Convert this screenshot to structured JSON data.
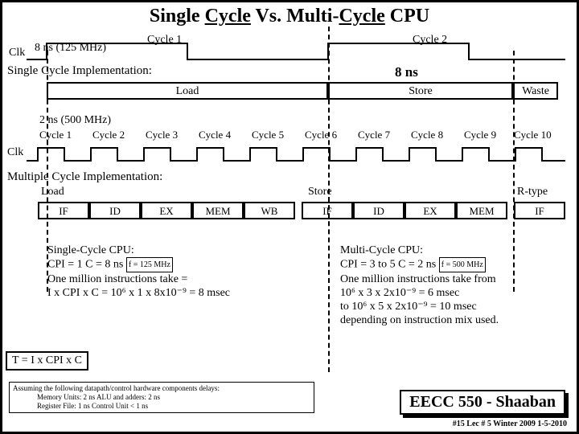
{
  "title_parts": {
    "p": "Single ",
    "u1": "Cycle",
    "mid": " Vs.  Multi-",
    "u2": "Cycle",
    "end": " CPU"
  },
  "single": {
    "clk": "Clk",
    "ns125": "8 ns (125 MHz)",
    "cycle1": "Cycle 1",
    "cycle2": "Cycle 2",
    "impl": "Single Cycle Implementation:",
    "eight": "8 ns",
    "load": "Load",
    "store": "Store",
    "waste": "Waste"
  },
  "multi": {
    "mhz": "2 ns   (500 MHz)",
    "cycles": [
      "Cycle 1",
      "Cycle 2",
      "Cycle 3",
      "Cycle 4",
      "Cycle 5",
      "Cycle 6",
      "Cycle 7",
      "Cycle 8",
      "Cycle 9",
      "Cycle 10"
    ],
    "clk": "Clk",
    "impl": "Multiple Cycle Implementation:",
    "load": "Load",
    "store": "Store",
    "rtype": "R-type",
    "stages": [
      "IF",
      "ID",
      "EX",
      "MEM",
      "WB",
      "IF",
      "ID",
      "EX",
      "MEM",
      "IF"
    ]
  },
  "calcL": {
    "h": "Single-Cycle CPU:",
    "l1a": "CPI = 1    C = 8 ns",
    "fbox": "f = 125 MHz",
    "l2": "One million instructions take =",
    "l3": "I x CPI x C  =  10⁶ x 1 x 8x10⁻⁹ =  8 msec"
  },
  "calcR": {
    "h": "Multi-Cycle CPU:",
    "l1a": "CPI =  3  to  5     C  =  2 ns",
    "fbox": "f = 500 MHz",
    "l2": "One million instructions take from",
    "l3": "     10⁶ x  3  x  2x10⁻⁹  =   6 msec",
    "l4": "to   10⁶ x  5  x  2x10⁻⁹  =  10 msec",
    "l5": "depending on instruction mix used."
  },
  "formula": "T = I x CPI x C",
  "assume": {
    "a": "Assuming the following datapath/control hardware components delays:",
    "b": "Memory Units: 2 ns     ALU and adders: 2 ns",
    "c": "Register File: 1 ns      Control Unit < 1 ns"
  },
  "course": "EECC 550 - Shaaban",
  "footer": "#15  Lec # 5  Winter 2009  1-5-2010",
  "chart_data": {
    "type": "table",
    "title": "Single Cycle vs Multi-Cycle CPU timing comparison",
    "single_cycle": {
      "clock_period_ns": 8,
      "freq_MHz": 125,
      "CPI": 1,
      "instructions": 1000000,
      "time_msec": 8,
      "cycle1_contents": "Load",
      "cycle2_contents": "Store + Waste"
    },
    "multi_cycle": {
      "clock_period_ns": 2,
      "freq_MHz": 500,
      "CPI_min": 3,
      "CPI_max": 5,
      "instructions": 1000000,
      "time_msec_min": 6,
      "time_msec_max": 10,
      "pipeline_rows": [
        {
          "instr": "Load",
          "cycles": [
            "IF",
            "ID",
            "EX",
            "MEM",
            "WB"
          ]
        },
        {
          "instr": "Store",
          "cycles": [
            "IF",
            "ID",
            "EX",
            "MEM"
          ]
        },
        {
          "instr": "R-type",
          "cycles": [
            "IF"
          ]
        }
      ]
    },
    "component_delays_ns": {
      "memory_units": 2,
      "alu_adders": 2,
      "register_file": 1,
      "control_unit_lt": 1
    }
  }
}
